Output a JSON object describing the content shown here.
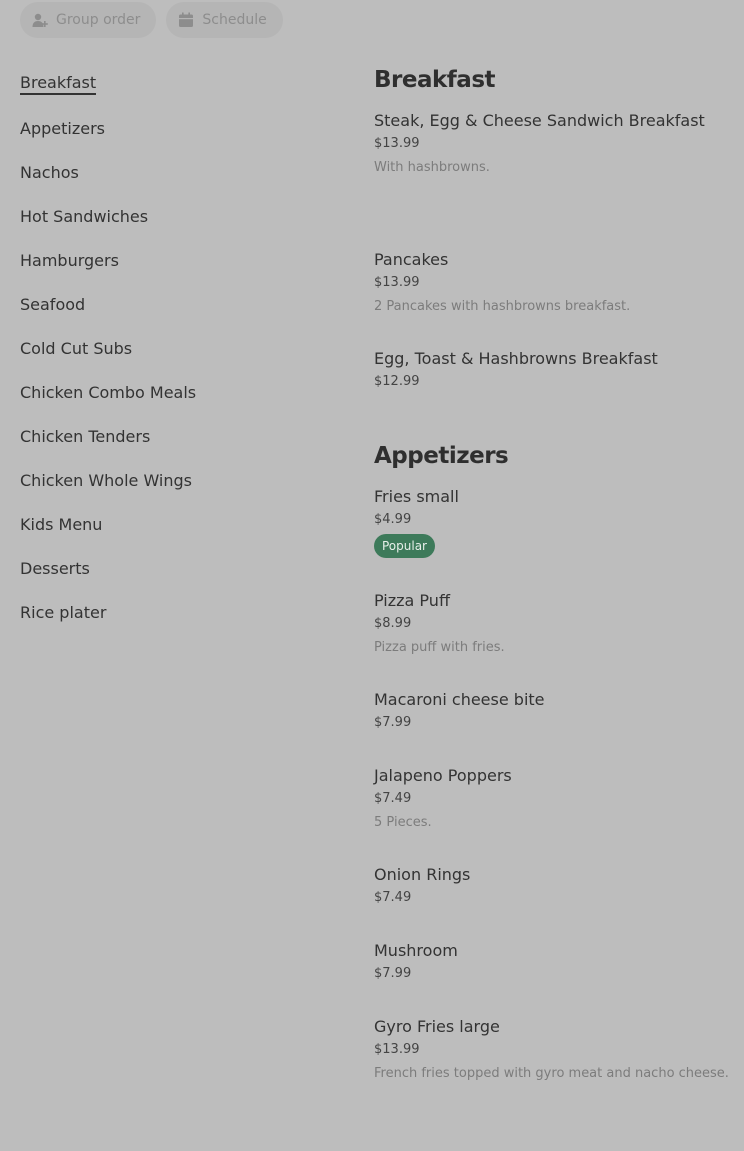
{
  "toolbar": {
    "group_order": {
      "label": "Group order",
      "icon": "person-add-icon"
    },
    "schedule": {
      "label": "Schedule",
      "icon": "calendar-icon"
    }
  },
  "sidebar": {
    "active": "Breakfast",
    "items": [
      {
        "label": "Breakfast"
      },
      {
        "label": "Appetizers"
      },
      {
        "label": "Nachos"
      },
      {
        "label": "Hot Sandwiches"
      },
      {
        "label": "Hamburgers"
      },
      {
        "label": "Seafood"
      },
      {
        "label": "Cold Cut Subs"
      },
      {
        "label": "Chicken Combo Meals"
      },
      {
        "label": "Chicken Tenders"
      },
      {
        "label": "Chicken Whole Wings"
      },
      {
        "label": "Kids Menu"
      },
      {
        "label": "Desserts"
      },
      {
        "label": "Rice plater"
      }
    ]
  },
  "colors": {
    "overlay_background": "#bdbdbd",
    "popular_badge": "#3d7a5a"
  },
  "menu": {
    "sections": [
      {
        "title": "Breakfast",
        "items": [
          {
            "name": "Steak, Egg & Cheese Sandwich Breakfast",
            "price": "$13.99",
            "description": "With hashbrowns."
          },
          {
            "name": "Pancakes",
            "price": "$13.99",
            "description": "2 Pancakes with hashbrowns breakfast."
          },
          {
            "name": "Egg, Toast & Hashbrowns Breakfast",
            "price": "$12.99"
          }
        ]
      },
      {
        "title": "Appetizers",
        "items": [
          {
            "name": "Fries small",
            "price": "$4.99",
            "badge": "Popular"
          },
          {
            "name": "Pizza Puff",
            "price": "$8.99",
            "description": "Pizza puff with fries."
          },
          {
            "name": "Macaroni cheese bite",
            "price": "$7.99"
          },
          {
            "name": "Jalapeno Poppers",
            "price": "$7.49",
            "description": "5 Pieces."
          },
          {
            "name": "Onion Rings",
            "price": "$7.49"
          },
          {
            "name": "Mushroom",
            "price": "$7.99"
          },
          {
            "name": "Gyro Fries large",
            "price": "$13.99",
            "description": "French fries topped with gyro meat and nacho cheese."
          }
        ]
      }
    ]
  }
}
